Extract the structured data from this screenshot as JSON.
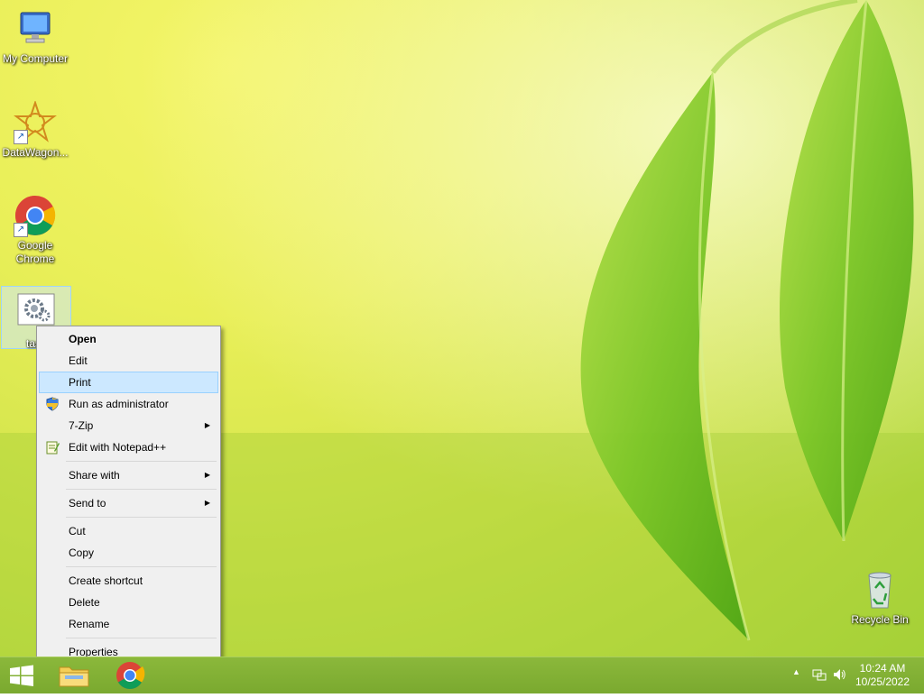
{
  "desktop": {
    "icons": [
      {
        "label": "My Computer",
        "name": "my-computer-icon"
      },
      {
        "label": "DataWagon...",
        "name": "datawagon-icon"
      },
      {
        "label": "Google Chrome",
        "name": "google-chrome-icon"
      },
      {
        "label": "task",
        "name": "task-file-icon"
      },
      {
        "label": "Recycle Bin",
        "name": "recycle-bin-icon"
      }
    ]
  },
  "context_menu": {
    "items": [
      {
        "label": "Open"
      },
      {
        "label": "Edit"
      },
      {
        "label": "Print"
      },
      {
        "label": "Run as administrator"
      },
      {
        "label": "7-Zip"
      },
      {
        "label": "Edit with Notepad++"
      },
      {
        "label": "Share with"
      },
      {
        "label": "Send to"
      },
      {
        "label": "Cut"
      },
      {
        "label": "Copy"
      },
      {
        "label": "Create shortcut"
      },
      {
        "label": "Delete"
      },
      {
        "label": "Rename"
      },
      {
        "label": "Properties"
      }
    ],
    "highlighted": "Print"
  },
  "taskbar": {
    "pinned": [
      "start-button",
      "file-explorer",
      "google-chrome"
    ],
    "clock": {
      "time": "10:24 AM",
      "date": "10/25/2022"
    }
  },
  "colors": {
    "menu_highlight": "#cce8ff",
    "taskbar": "#7aa92f"
  }
}
